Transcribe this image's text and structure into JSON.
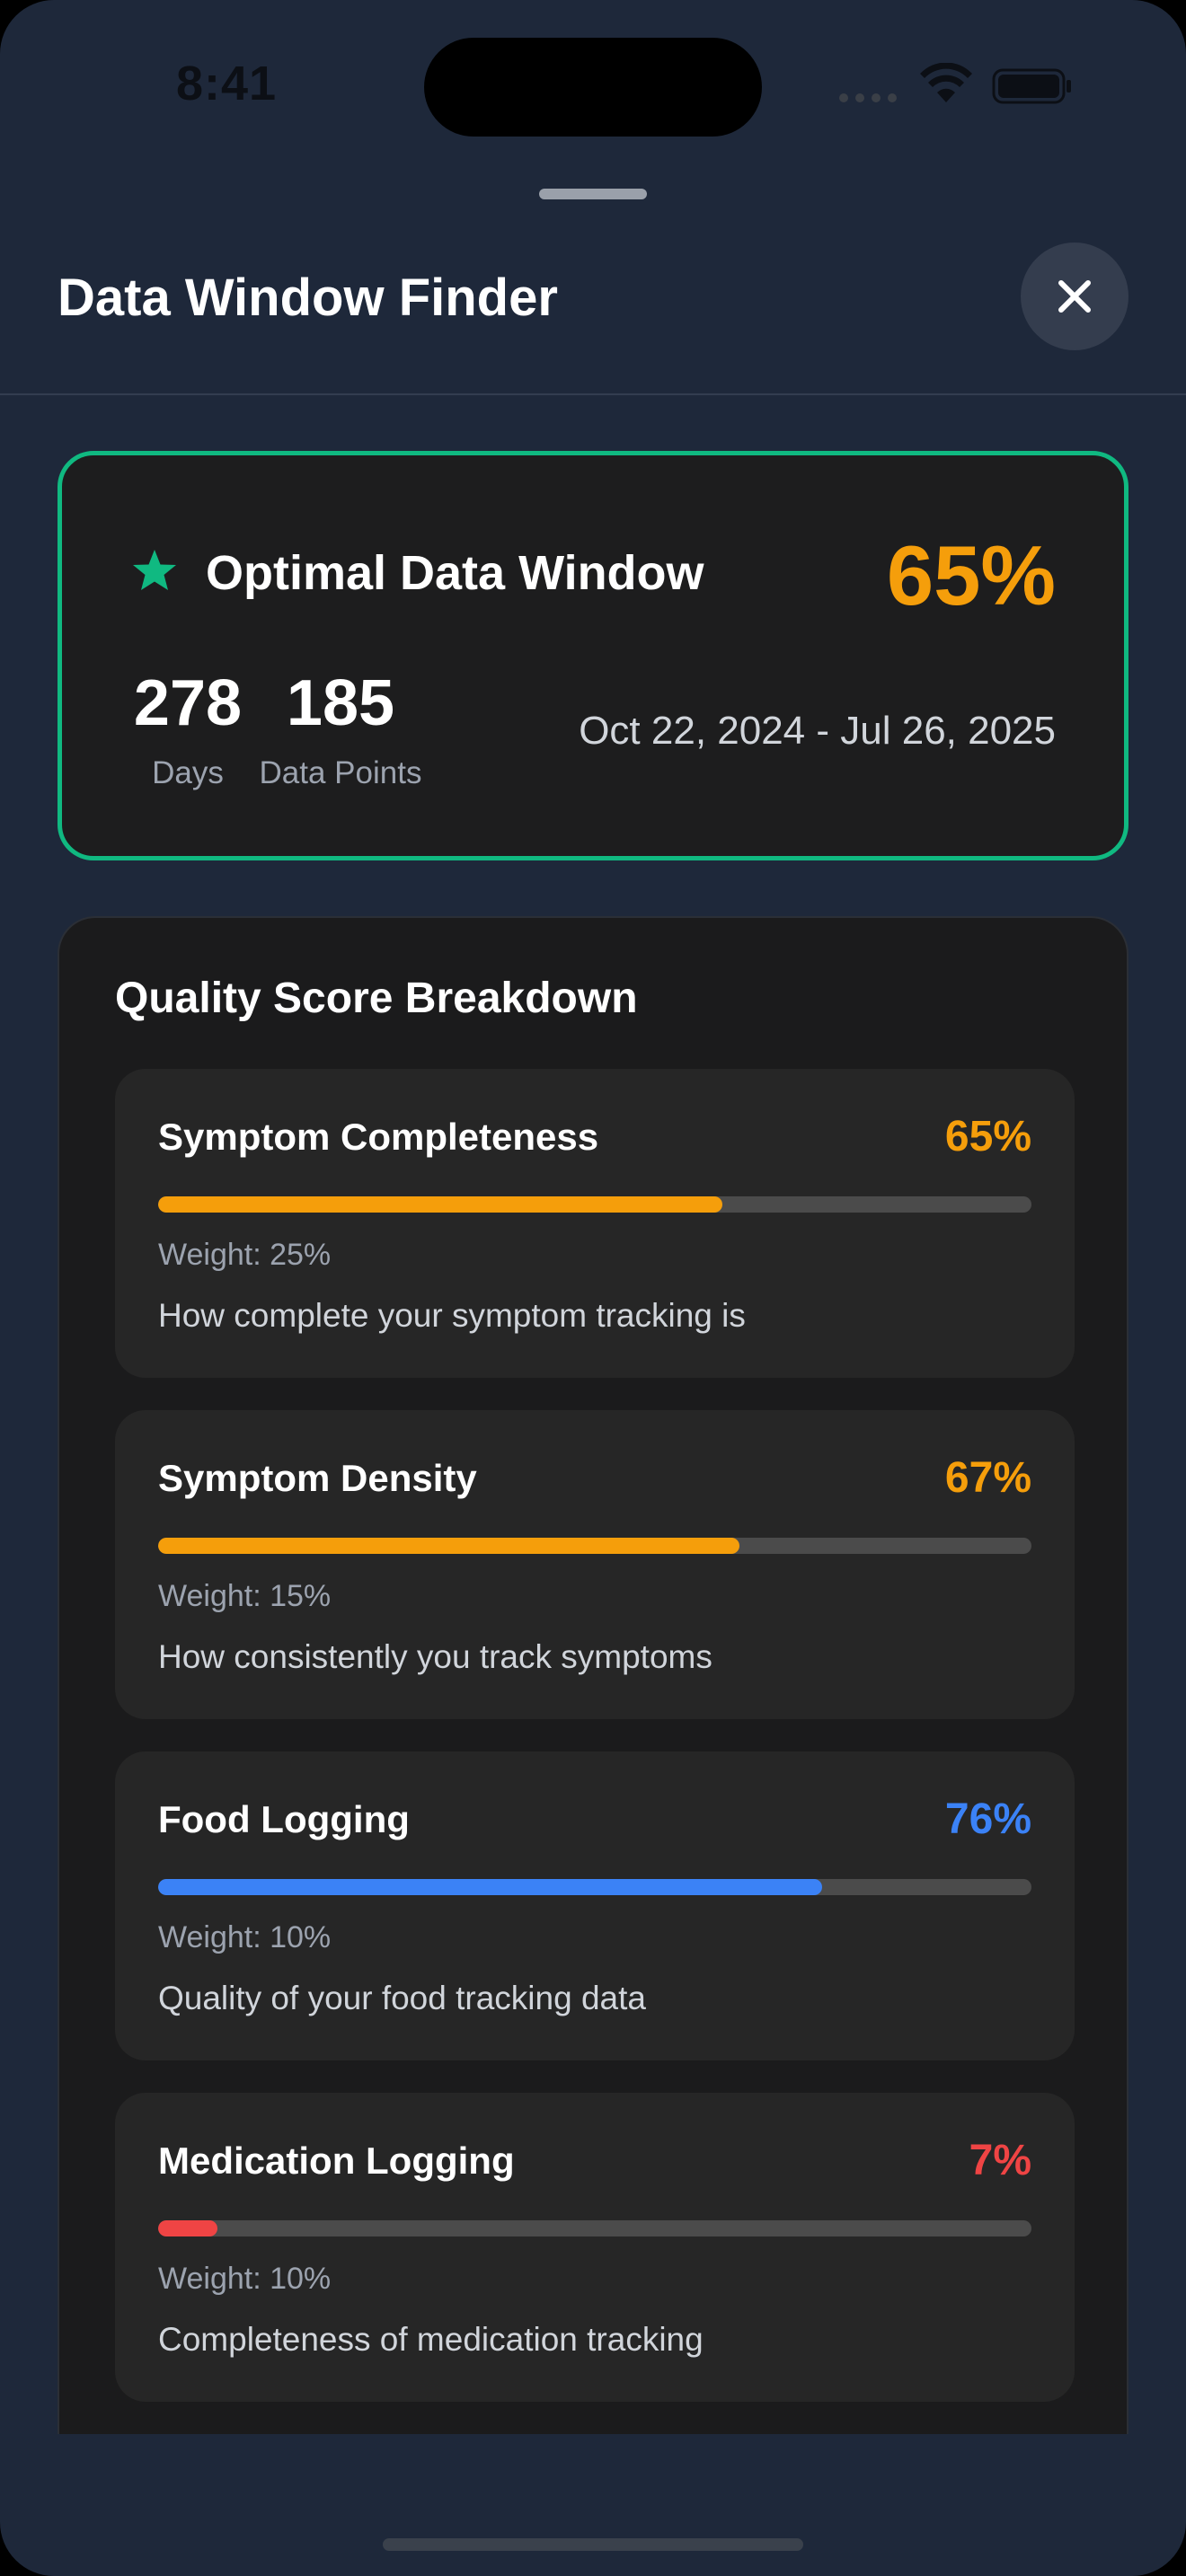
{
  "status_bar": {
    "time": "8:41"
  },
  "header": {
    "title": "Data Window Finder",
    "close_icon": "close-icon"
  },
  "optimal": {
    "label": "Optimal Data Window",
    "score": "65%",
    "days_value": "278",
    "days_label": "Days",
    "points_value": "185",
    "points_label": "Data Points",
    "date_range": "Oct 22, 2024 - Jul 26, 2025",
    "accent": "#10b981",
    "score_color": "#f59e0b"
  },
  "breakdown": {
    "title": "Quality Score Breakdown",
    "metrics": [
      {
        "name": "Symptom Completeness",
        "value": "65%",
        "fraction": 0.646,
        "weight": "Weight: 25%",
        "description": "How complete your symptom tracking is",
        "color": "#f59e0b"
      },
      {
        "name": "Symptom Density",
        "value": "67%",
        "fraction": 0.666,
        "weight": "Weight: 15%",
        "description": "How consistently you track symptoms",
        "color": "#f59e0b"
      },
      {
        "name": "Food Logging",
        "value": "76%",
        "fraction": 0.76,
        "weight": "Weight: 10%",
        "description": "Quality of your food tracking data",
        "color": "#3b82f6"
      },
      {
        "name": "Medication Logging",
        "value": "7%",
        "fraction": 0.068,
        "weight": "Weight: 10%",
        "description": "Completeness of medication tracking",
        "color": "#ef4444"
      }
    ]
  }
}
